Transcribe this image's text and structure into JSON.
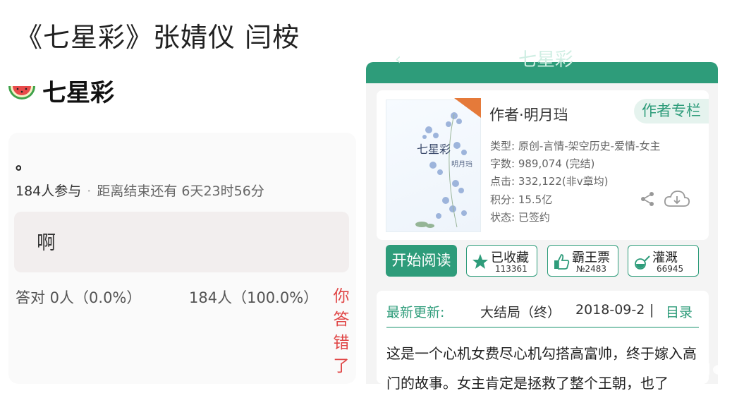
{
  "post": {
    "title": "《七星彩》张婧仪 闫桉"
  },
  "left_app": {
    "icon": "watermelon-icon",
    "title": "七星彩",
    "question_mark": "。",
    "participants": "184人参与",
    "separator": "·",
    "countdown": "距离结束还有 6天23时56分",
    "answer": "啊",
    "correct_stat": "答对 0人（0.0%）",
    "wrong_stat": "184人（100.0%）",
    "wrong_label": "你答错了"
  },
  "right_app": {
    "header_title": "七星彩",
    "back_icon": "back-arrow-icon",
    "cover": {
      "title": "七星彩",
      "author": "明月珰",
      "badge_icon": "signed-badge-icon"
    },
    "author_line": "作者·明月珰",
    "author_column_button": "作者专栏",
    "info": {
      "type": "类型: 原创-言情-架空历史-爱情-女主",
      "words": "字数: 989,074 (完结)",
      "clicks": "点击: 332,122(非v章均)",
      "points": "积分: 15.5亿",
      "status": "状态: 已签约"
    },
    "read_button": "开始阅读",
    "favorite": {
      "label": "已收藏",
      "count": "113361",
      "icon": "star-icon"
    },
    "ticket": {
      "label": "霸王票",
      "count": "№2483",
      "icon": "thumbs-up-icon"
    },
    "water": {
      "label": "灌溉",
      "count": "66945",
      "icon": "watering-can-icon"
    },
    "update": {
      "label": "最新更新:",
      "chapter": "大结局（终）",
      "date": "2018-09-2",
      "divider": "|",
      "catalog": "目录"
    },
    "summary": "这是一个心机女费尽心机勾搭高富帅，终于嫁入高门的故事。女主肯定是拯救了整个王朝，也了"
  },
  "colors": {
    "accent_green": "#2e9c7a",
    "wrong_red": "#e04545",
    "light_green": "#e5f3ee"
  }
}
